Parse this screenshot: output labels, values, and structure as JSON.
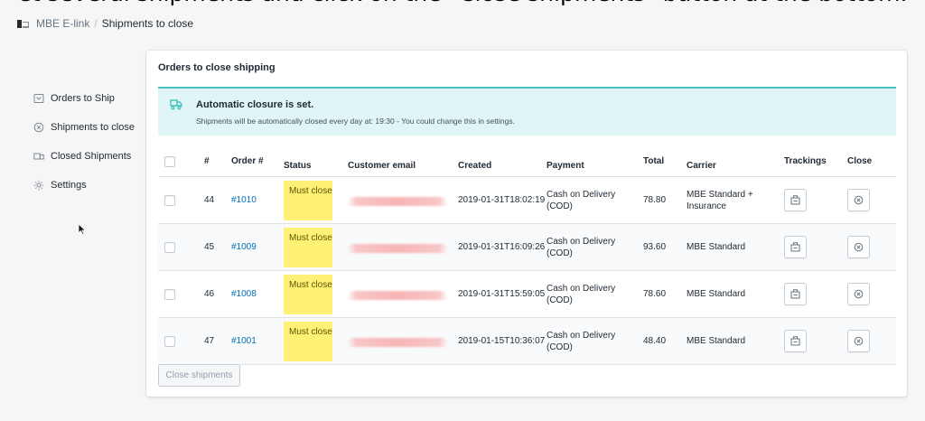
{
  "caption": "et several shipments and click on the \"Close shipments\" button at the bottom.",
  "topbar": {
    "app_name": "MBE E-link",
    "separator": "/",
    "page_name": "Shipments to close"
  },
  "sidebar": {
    "items": [
      {
        "label": "Orders to Ship",
        "icon": "box-icon"
      },
      {
        "label": "Shipments to close",
        "icon": "circle-x-icon"
      },
      {
        "label": "Closed Shipments",
        "icon": "shipment-icon"
      },
      {
        "label": "Settings",
        "icon": "gear-icon"
      }
    ]
  },
  "card": {
    "title": "Orders to close shipping"
  },
  "banner": {
    "title": "Automatic closure is set.",
    "text": "Shipments will be automatically closed every day at: 19:30 - You could change this in settings.",
    "accent_color": "#47c1bf",
    "background_color": "#e0f5f5"
  },
  "table": {
    "headers": {
      "num": "#",
      "order": "Order #",
      "status": "Status",
      "email": "Customer email",
      "created": "Created",
      "payment": "Payment",
      "total": "Total",
      "carrier": "Carrier",
      "trackings": "Trackings",
      "close": "Close"
    },
    "rows": [
      {
        "num": "44",
        "order": "#1010",
        "status": "Must close",
        "created": "2019-01-31T18:02:19",
        "payment": "Cash on Delivery (COD)",
        "total": "78.80",
        "carrier": "MBE Standard + Insurance"
      },
      {
        "num": "45",
        "order": "#1009",
        "status": "Must close",
        "created": "2019-01-31T16:09:26",
        "payment": "Cash on Delivery (COD)",
        "total": "93.60",
        "carrier": "MBE Standard"
      },
      {
        "num": "46",
        "order": "#1008",
        "status": "Must close",
        "created": "2019-01-31T15:59:05",
        "payment": "Cash on Delivery (COD)",
        "total": "78.60",
        "carrier": "MBE Standard"
      },
      {
        "num": "47",
        "order": "#1001",
        "status": "Must close",
        "created": "2019-01-15T10:36:07",
        "payment": "Cash on Delivery (COD)",
        "total": "48.40",
        "carrier": "MBE Standard"
      }
    ],
    "status_color": "#fff176",
    "link_color": "#006fbb"
  },
  "footer": {
    "close_shipments_label": "Close shipments"
  }
}
